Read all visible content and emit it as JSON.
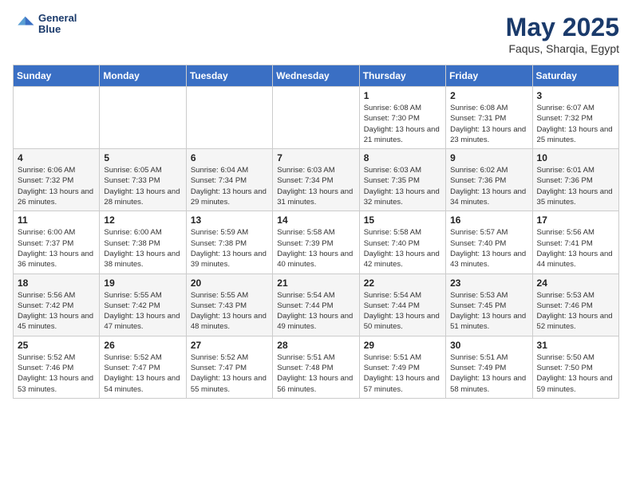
{
  "header": {
    "logo_line1": "General",
    "logo_line2": "Blue",
    "title": "May 2025",
    "subtitle": "Faqus, Sharqia, Egypt"
  },
  "days_of_week": [
    "Sunday",
    "Monday",
    "Tuesday",
    "Wednesday",
    "Thursday",
    "Friday",
    "Saturday"
  ],
  "weeks": [
    [
      {
        "date": "",
        "info": ""
      },
      {
        "date": "",
        "info": ""
      },
      {
        "date": "",
        "info": ""
      },
      {
        "date": "",
        "info": ""
      },
      {
        "date": "1",
        "info": "Sunrise: 6:08 AM\nSunset: 7:30 PM\nDaylight: 13 hours and 21 minutes."
      },
      {
        "date": "2",
        "info": "Sunrise: 6:08 AM\nSunset: 7:31 PM\nDaylight: 13 hours and 23 minutes."
      },
      {
        "date": "3",
        "info": "Sunrise: 6:07 AM\nSunset: 7:32 PM\nDaylight: 13 hours and 25 minutes."
      }
    ],
    [
      {
        "date": "4",
        "info": "Sunrise: 6:06 AM\nSunset: 7:32 PM\nDaylight: 13 hours and 26 minutes."
      },
      {
        "date": "5",
        "info": "Sunrise: 6:05 AM\nSunset: 7:33 PM\nDaylight: 13 hours and 28 minutes."
      },
      {
        "date": "6",
        "info": "Sunrise: 6:04 AM\nSunset: 7:34 PM\nDaylight: 13 hours and 29 minutes."
      },
      {
        "date": "7",
        "info": "Sunrise: 6:03 AM\nSunset: 7:34 PM\nDaylight: 13 hours and 31 minutes."
      },
      {
        "date": "8",
        "info": "Sunrise: 6:03 AM\nSunset: 7:35 PM\nDaylight: 13 hours and 32 minutes."
      },
      {
        "date": "9",
        "info": "Sunrise: 6:02 AM\nSunset: 7:36 PM\nDaylight: 13 hours and 34 minutes."
      },
      {
        "date": "10",
        "info": "Sunrise: 6:01 AM\nSunset: 7:36 PM\nDaylight: 13 hours and 35 minutes."
      }
    ],
    [
      {
        "date": "11",
        "info": "Sunrise: 6:00 AM\nSunset: 7:37 PM\nDaylight: 13 hours and 36 minutes."
      },
      {
        "date": "12",
        "info": "Sunrise: 6:00 AM\nSunset: 7:38 PM\nDaylight: 13 hours and 38 minutes."
      },
      {
        "date": "13",
        "info": "Sunrise: 5:59 AM\nSunset: 7:38 PM\nDaylight: 13 hours and 39 minutes."
      },
      {
        "date": "14",
        "info": "Sunrise: 5:58 AM\nSunset: 7:39 PM\nDaylight: 13 hours and 40 minutes."
      },
      {
        "date": "15",
        "info": "Sunrise: 5:58 AM\nSunset: 7:40 PM\nDaylight: 13 hours and 42 minutes."
      },
      {
        "date": "16",
        "info": "Sunrise: 5:57 AM\nSunset: 7:40 PM\nDaylight: 13 hours and 43 minutes."
      },
      {
        "date": "17",
        "info": "Sunrise: 5:56 AM\nSunset: 7:41 PM\nDaylight: 13 hours and 44 minutes."
      }
    ],
    [
      {
        "date": "18",
        "info": "Sunrise: 5:56 AM\nSunset: 7:42 PM\nDaylight: 13 hours and 45 minutes."
      },
      {
        "date": "19",
        "info": "Sunrise: 5:55 AM\nSunset: 7:42 PM\nDaylight: 13 hours and 47 minutes."
      },
      {
        "date": "20",
        "info": "Sunrise: 5:55 AM\nSunset: 7:43 PM\nDaylight: 13 hours and 48 minutes."
      },
      {
        "date": "21",
        "info": "Sunrise: 5:54 AM\nSunset: 7:44 PM\nDaylight: 13 hours and 49 minutes."
      },
      {
        "date": "22",
        "info": "Sunrise: 5:54 AM\nSunset: 7:44 PM\nDaylight: 13 hours and 50 minutes."
      },
      {
        "date": "23",
        "info": "Sunrise: 5:53 AM\nSunset: 7:45 PM\nDaylight: 13 hours and 51 minutes."
      },
      {
        "date": "24",
        "info": "Sunrise: 5:53 AM\nSunset: 7:46 PM\nDaylight: 13 hours and 52 minutes."
      }
    ],
    [
      {
        "date": "25",
        "info": "Sunrise: 5:52 AM\nSunset: 7:46 PM\nDaylight: 13 hours and 53 minutes."
      },
      {
        "date": "26",
        "info": "Sunrise: 5:52 AM\nSunset: 7:47 PM\nDaylight: 13 hours and 54 minutes."
      },
      {
        "date": "27",
        "info": "Sunrise: 5:52 AM\nSunset: 7:47 PM\nDaylight: 13 hours and 55 minutes."
      },
      {
        "date": "28",
        "info": "Sunrise: 5:51 AM\nSunset: 7:48 PM\nDaylight: 13 hours and 56 minutes."
      },
      {
        "date": "29",
        "info": "Sunrise: 5:51 AM\nSunset: 7:49 PM\nDaylight: 13 hours and 57 minutes."
      },
      {
        "date": "30",
        "info": "Sunrise: 5:51 AM\nSunset: 7:49 PM\nDaylight: 13 hours and 58 minutes."
      },
      {
        "date": "31",
        "info": "Sunrise: 5:50 AM\nSunset: 7:50 PM\nDaylight: 13 hours and 59 minutes."
      }
    ]
  ]
}
